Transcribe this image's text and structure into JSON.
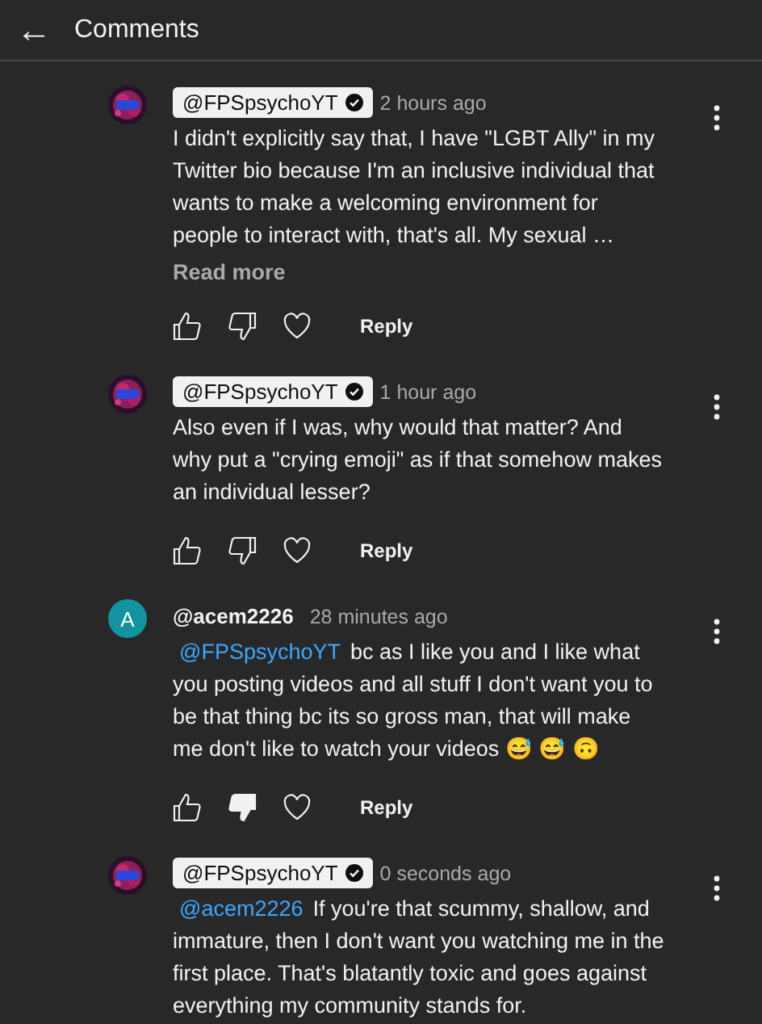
{
  "header": {
    "back_icon": "←",
    "title": "Comments"
  },
  "comments": [
    {
      "author": "@FPSpsychoYT",
      "creator": true,
      "verified": true,
      "time": "2 hours ago",
      "text": "I didn't explicitly say that, I have \"LGBT Ally\" in my Twitter bio because I'm an inclusive individual that wants to make a welcoming environment for people to interact with, that's all. My sexual …",
      "read_more": "Read more",
      "actions": {
        "liked": false,
        "disliked": false,
        "hearted": false,
        "reply": "Reply"
      }
    },
    {
      "author": "@FPSpsychoYT",
      "creator": true,
      "verified": true,
      "time": "1 hour ago",
      "text": "Also even if I was, why would that matter? And why put a \"crying emoji\" as if that somehow makes an individual lesser?",
      "actions": {
        "liked": false,
        "disliked": false,
        "hearted": false,
        "reply": "Reply"
      }
    },
    {
      "avatar": {
        "kind": "letter",
        "letter": "A",
        "color": "#12939f"
      },
      "author": "@acem2226",
      "creator": false,
      "time": "28 minutes ago",
      "mention": "@FPSpsychoYT",
      "text": "bc as I like you and I like what you posting videos and all stuff I don't want you to be that thing bc its so gross man, that will make me don't like to watch your videos 😅 😅 🙃",
      "actions": {
        "liked": false,
        "disliked": true,
        "hearted": false,
        "reply": "Reply"
      }
    },
    {
      "author": "@FPSpsychoYT",
      "creator": true,
      "verified": true,
      "time": "0 seconds ago",
      "mention": "@acem2226",
      "text": "If you're that scummy, shallow, and immature, then I don't want you watching me in the first place. That's blatantly toxic and goes against everything my community stands for."
    }
  ]
}
